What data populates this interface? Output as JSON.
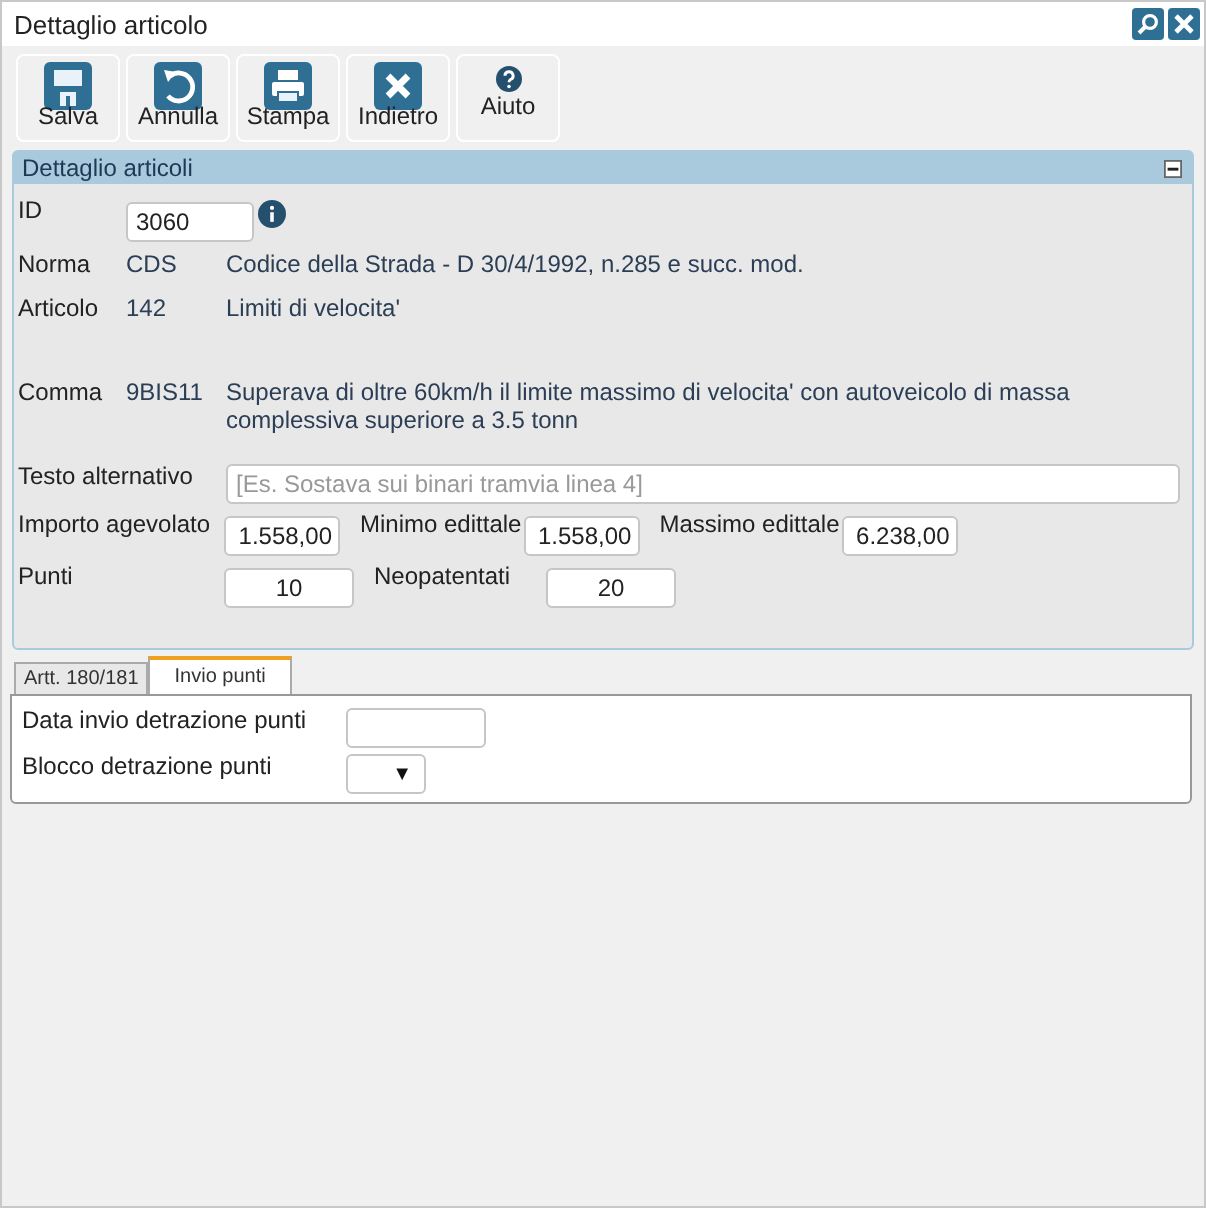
{
  "window": {
    "title": "Dettaglio articolo"
  },
  "toolbar": [
    {
      "label": "Salva",
      "kind": "save"
    },
    {
      "label": "Annulla",
      "kind": "undo"
    },
    {
      "label": "Stampa",
      "kind": "print"
    },
    {
      "label": "Indietro",
      "kind": "back"
    },
    {
      "label": "Aiuto",
      "kind": "help"
    }
  ],
  "panel": {
    "title": "Dettaglio articoli",
    "id": {
      "label": "ID",
      "value": "3060"
    },
    "rows": [
      {
        "label": "Norma",
        "code": "CDS",
        "description": "Codice della Strada - D 30/4/1992, n.285 e succ. mod."
      },
      {
        "label": "Articolo",
        "code": "142",
        "description": "Limiti di velocita'"
      },
      {
        "label": "Comma",
        "code": "9BIS11",
        "description": "Superava di oltre 60km/h il limite massimo di velocita' con autoveicolo di massa complessiva superiore a 3.5 tonn"
      }
    ],
    "alt_text": {
      "label": "Testo alternativo",
      "placeholder": "[Es. Sostava sui binari tramvia linea 4]"
    },
    "amounts": [
      {
        "label": "Importo agevolato",
        "value": "1.558,00"
      },
      {
        "label": "Minimo edittale",
        "value": "1.558,00"
      },
      {
        "label": "Massimo edittale",
        "value": "6.238,00"
      }
    ],
    "points": [
      {
        "label": "Punti",
        "value": "10"
      },
      {
        "label": "Neopatentati",
        "value": "20"
      }
    ]
  },
  "tabs": [
    {
      "label": "Artt. 180/181",
      "selected": false
    },
    {
      "label": "Invio punti",
      "selected": true
    }
  ],
  "tab_content": {
    "date_label": "Data invio detrazione punti",
    "block_label": "Blocco detrazione punti",
    "dropdown_arrow": "▼"
  }
}
